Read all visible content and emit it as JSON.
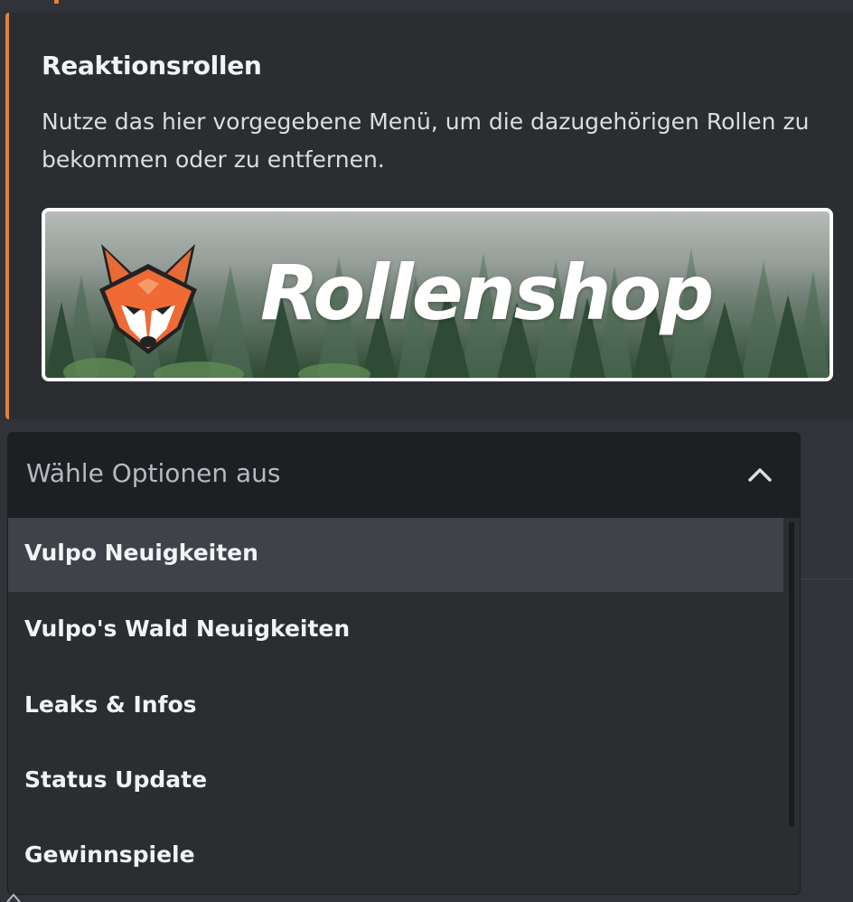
{
  "embed": {
    "title": "Reaktionsrollen",
    "description": "Nutze das hier vorgegebene Menü, um die dazugehörigen Rollen zu bekommen oder zu entfernen.",
    "banner_text": "Rollenshop",
    "accent_color": "#e0823d"
  },
  "select_menu": {
    "placeholder": "Wähle Optionen aus",
    "expanded": true,
    "options": [
      {
        "label": "Vulpo Neuigkeiten",
        "highlighted": true
      },
      {
        "label": "Vulpo's Wald Neuigkeiten",
        "highlighted": false
      },
      {
        "label": "Leaks & Infos",
        "highlighted": false
      },
      {
        "label": "Status Update",
        "highlighted": false
      },
      {
        "label": "Gewinnspiele",
        "highlighted": false
      }
    ]
  },
  "icons": {
    "banner_logo": "fox-head-icon",
    "select_toggle": "chevron-up-icon"
  }
}
